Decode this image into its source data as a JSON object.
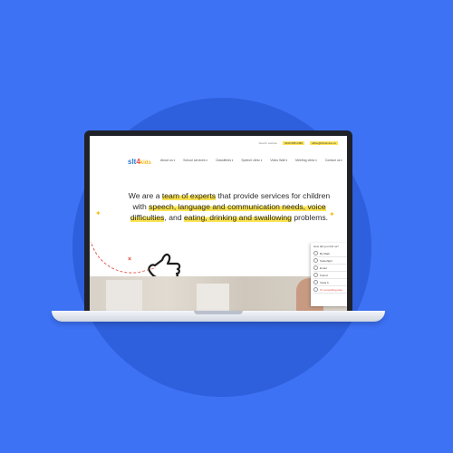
{
  "colors": {
    "background": "#3d72f5",
    "circle": "#2e5fdc",
    "highlight": "#fbe452",
    "accent_red": "#e04b3c",
    "accent_yellow": "#f1c11a"
  },
  "site": {
    "topbar": {
      "search": "Search website",
      "phone": "0330 088 2489",
      "email": "office@thinkmine.co"
    },
    "logo": {
      "part1": "slt",
      "part2": "4",
      "part3": "kids"
    },
    "nav": [
      "About us",
      "School services",
      "Classifieds",
      "Speech clinic",
      "Video Wall",
      "Meeting clinic",
      "Contact us"
    ],
    "hero": {
      "t1": "We are a ",
      "h1": "team of experts",
      "t2": " that provide services for children with ",
      "h2": "speech, language and communication needs, voice difficulties",
      "t3": ", and ",
      "h3": "eating, drinking and swallowing",
      "t4": " problems."
    },
    "poll": {
      "question": "How did you find us?",
      "options": [
        "By Mark",
        "Sutterfight",
        "Email",
        "Friend",
        "Visits A"
      ],
      "other": "I'm something else"
    }
  }
}
